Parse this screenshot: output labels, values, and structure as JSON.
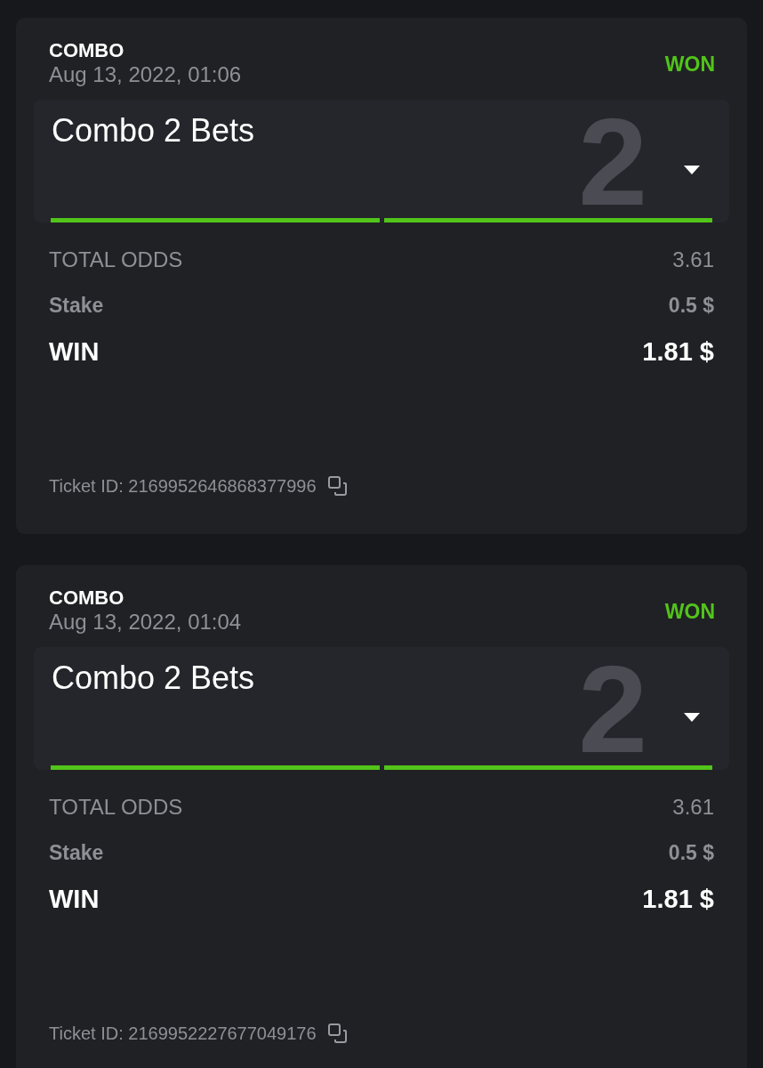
{
  "tickets": [
    {
      "type": "COMBO",
      "date": "Aug 13, 2022, 01:06",
      "status": "WON",
      "title": "Combo 2 Bets",
      "count": "2",
      "expanded": false,
      "legs": [
        {
          "won": true
        },
        {
          "won": true
        }
      ],
      "rows": [
        {
          "kind": "odds",
          "label": "TOTAL ODDS",
          "value": "3.61"
        },
        {
          "kind": "stake",
          "label": "Stake",
          "value": "0.5 $"
        },
        {
          "kind": "win",
          "label": "WIN",
          "value": "1.81 $"
        }
      ],
      "ticket_id": "Ticket ID: 2169952646868377996"
    },
    {
      "type": "COMBO",
      "date": "Aug 13, 2022, 01:04",
      "status": "WON",
      "title": "Combo 2 Bets",
      "count": "2",
      "expanded": false,
      "legs": [
        {
          "won": true
        },
        {
          "won": true
        }
      ],
      "rows": [
        {
          "kind": "odds",
          "label": "TOTAL ODDS",
          "value": "3.61"
        },
        {
          "kind": "stake",
          "label": "Stake",
          "value": "0.5 $"
        },
        {
          "kind": "win",
          "label": "WIN",
          "value": "1.81 $"
        }
      ],
      "ticket_id": "Ticket ID: 2169952227677049176"
    }
  ]
}
